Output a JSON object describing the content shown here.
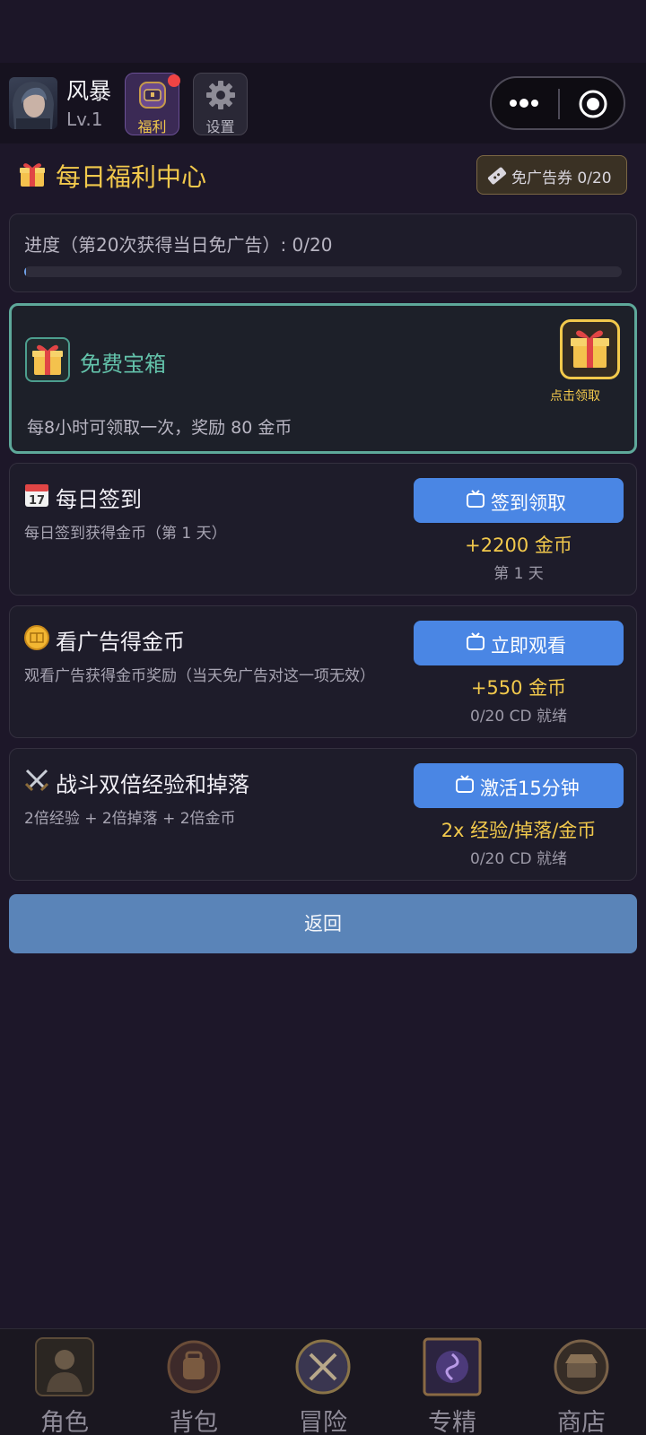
{
  "topbar": {
    "player_name": "风暴",
    "player_level": "Lv.1",
    "fuli_label": "福利",
    "settings_label": "设置"
  },
  "header": {
    "title": "每日福利中心",
    "voucher_text": "免广告券 0/20"
  },
  "progress": {
    "text": "进度（第20次获得当日免广告）: 0/20",
    "value": 0,
    "max": 20
  },
  "free_chest": {
    "title": "免费宝箱",
    "description": "每8小时可领取一次，奖励 80 金币",
    "claim_label": "点击领取"
  },
  "tasks": [
    {
      "icon": "calendar-icon",
      "title": "每日签到",
      "description": "每日签到获得金币（第 1 天）",
      "button": "签到领取",
      "reward": "+2200 金币",
      "sub": "第 1 天"
    },
    {
      "icon": "coin-icon",
      "title": "看广告得金币",
      "description": "观看广告获得金币奖励（当天免广告对这一项无效）",
      "button": "立即观看",
      "reward": "+550 金币",
      "sub": "0/20  CD 就绪"
    },
    {
      "icon": "crossed-swords-icon",
      "title": "战斗双倍经验和掉落",
      "description": "2倍经验 + 2倍掉落 + 2倍金币",
      "button": "激活15分钟",
      "reward": "2x 经验/掉落/金币",
      "sub": "0/20  CD 就绪"
    }
  ],
  "back_label": "返回",
  "bottom_nav": [
    {
      "label": "角色",
      "icon": "character-icon"
    },
    {
      "label": "背包",
      "icon": "backpack-icon"
    },
    {
      "label": "冒险",
      "icon": "adventure-icon"
    },
    {
      "label": "专精",
      "icon": "mastery-icon"
    },
    {
      "label": "商店",
      "icon": "shop-icon"
    }
  ],
  "colors": {
    "accent_gold": "#f2c94c",
    "button_blue": "#4a86e4",
    "teal": "#5ea89a",
    "background": "#1d1729"
  }
}
